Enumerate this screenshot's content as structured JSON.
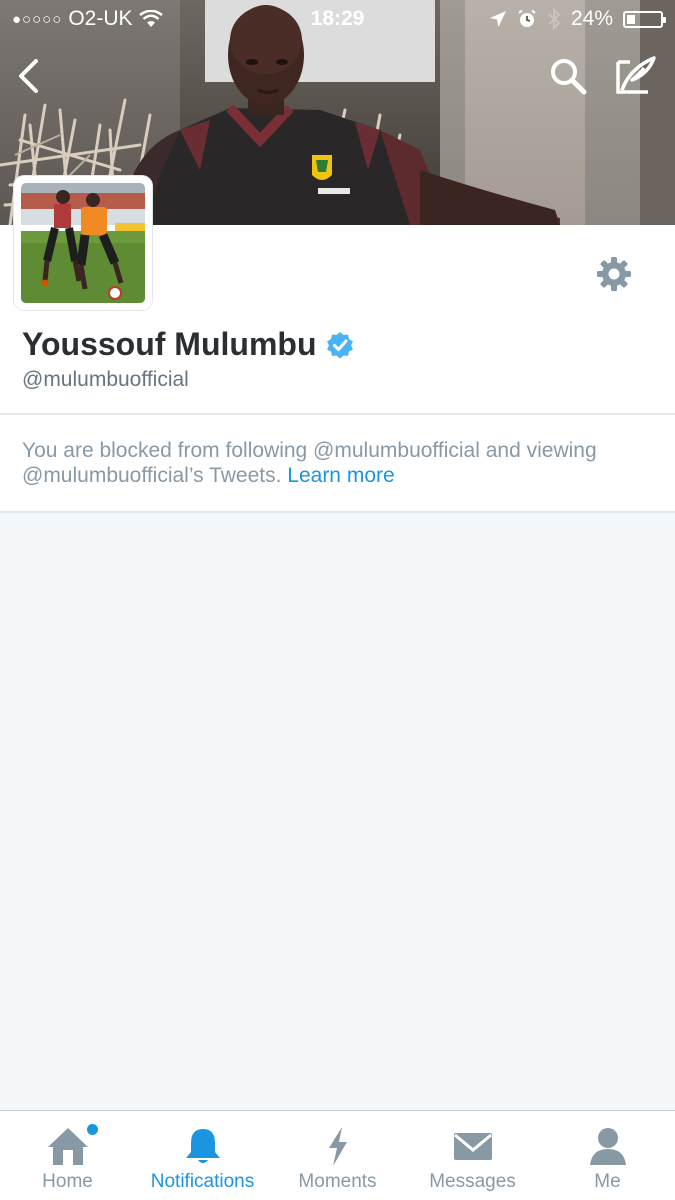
{
  "status_bar": {
    "signal_dots": "●○○○○",
    "carrier": "O2-UK",
    "time": "18:29",
    "battery_percent": "24%",
    "battery_level": 0.24
  },
  "profile": {
    "display_name": "Youssouf Mulumbu",
    "handle": "@mulumbuofficial",
    "verified": true
  },
  "blocked_notice": {
    "message": "You are blocked from following @mulumbuofficial and viewing @mulumbuofficial’s Tweets.",
    "link_text": "Learn more"
  },
  "tabs": [
    {
      "label": "Home",
      "icon": "home-icon",
      "active": false,
      "has_new": true
    },
    {
      "label": "Notifications",
      "icon": "bell-icon",
      "active": true
    },
    {
      "label": "Moments",
      "icon": "lightning-icon",
      "active": false
    },
    {
      "label": "Messages",
      "icon": "envelope-icon",
      "active": false
    },
    {
      "label": "Me",
      "icon": "person-icon",
      "active": false
    }
  ],
  "colors": {
    "accent": "#1b95e0",
    "verified": "#4ab3f4",
    "text_primary": "#292f33",
    "text_secondary": "#8899a6",
    "background": "#f5f8fa"
  }
}
